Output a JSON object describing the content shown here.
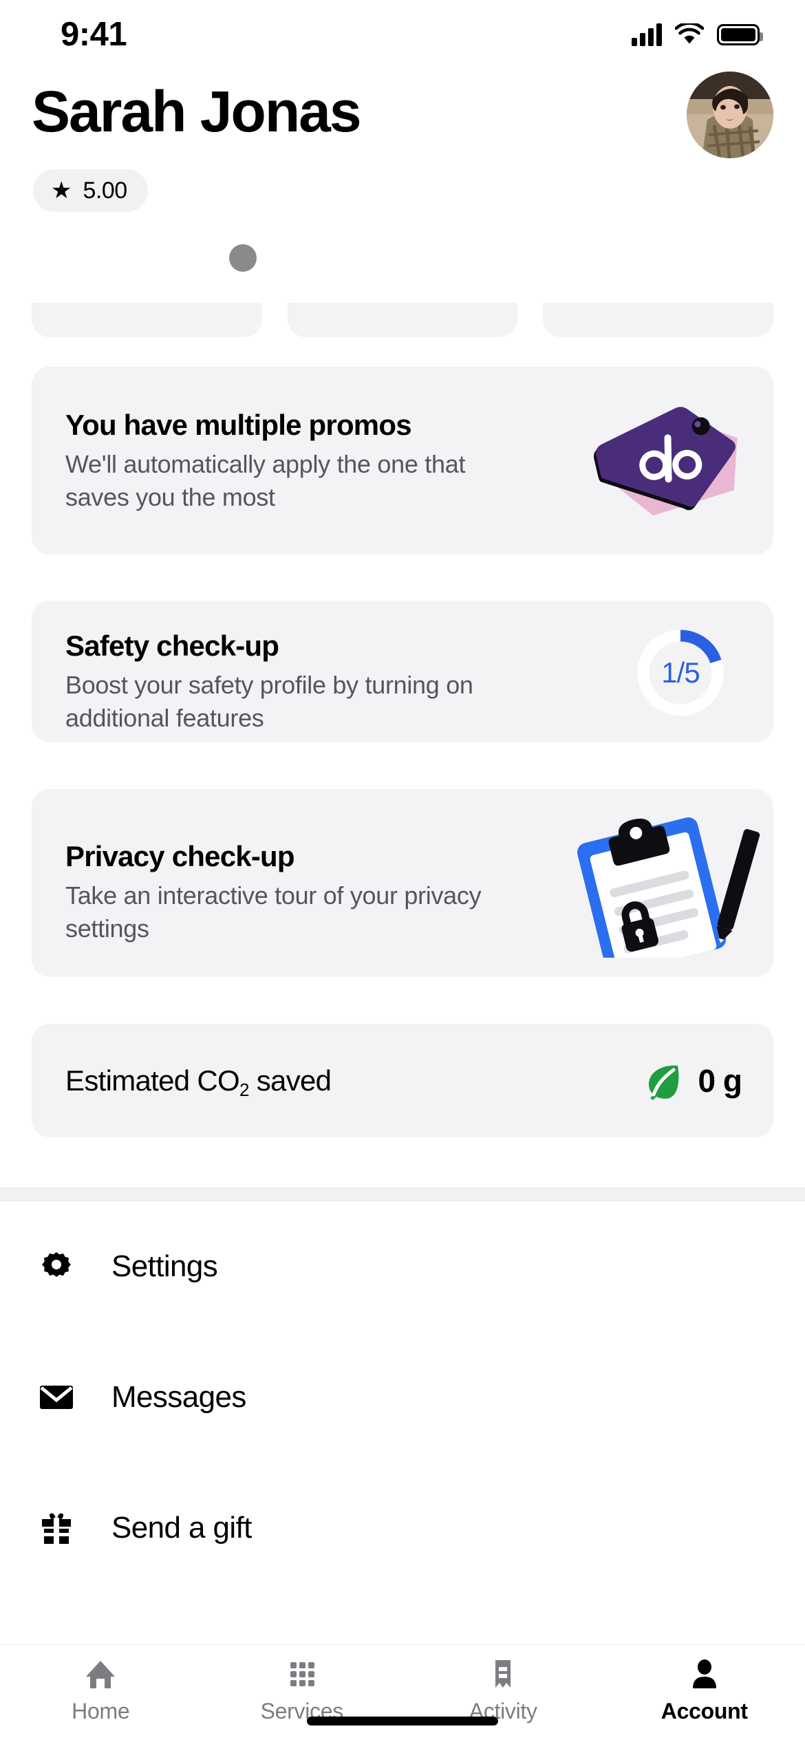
{
  "status_bar": {
    "time": "9:41",
    "cellular_icon": "signal-bars-icon",
    "wifi_icon": "wifi-icon",
    "battery_icon": "battery-icon"
  },
  "header": {
    "name": "Sarah Jonas",
    "rating_star": "★",
    "rating_value": "5.00",
    "avatar": "profile-photo"
  },
  "cards": {
    "promo": {
      "title": "You have multiple promos",
      "subtitle": "We'll automatically apply the one that saves you the most",
      "art": "promo-tag-illustration",
      "tag_symbol": "%",
      "tag_color": "#4a2d7a",
      "tag_back_color": "#e9b6d4"
    },
    "safety": {
      "title": "Safety check-up",
      "subtitle": "Boost your safety profile by turning on additional features",
      "progress_label": "1/5",
      "progress_completed": 1,
      "progress_total": 5,
      "progress_color": "#2b5fe3",
      "track_color": "#ffffff"
    },
    "privacy": {
      "title": "Privacy check-up",
      "subtitle": "Take an interactive tour of your privacy settings",
      "art": "privacy-clipboard-illustration",
      "clipboard_color": "#2b6ef0"
    },
    "co2": {
      "label_prefix": "Estimated CO",
      "label_sub": "2",
      "label_suffix": " saved",
      "leaf_icon": "leaf-icon",
      "leaf_color": "#1e9e3e",
      "value": "0 g"
    }
  },
  "menu": {
    "items": [
      {
        "label": "Settings",
        "icon": "gear-icon"
      },
      {
        "label": "Messages",
        "icon": "envelope-icon"
      },
      {
        "label": "Send a gift",
        "icon": "gift-icon"
      }
    ]
  },
  "tabbar": {
    "tabs": [
      {
        "label": "Home",
        "icon": "home-icon",
        "active": false
      },
      {
        "label": "Services",
        "icon": "grid-icon",
        "active": false
      },
      {
        "label": "Activity",
        "icon": "receipt-icon",
        "active": false
      },
      {
        "label": "Account",
        "icon": "person-icon",
        "active": true
      }
    ]
  }
}
